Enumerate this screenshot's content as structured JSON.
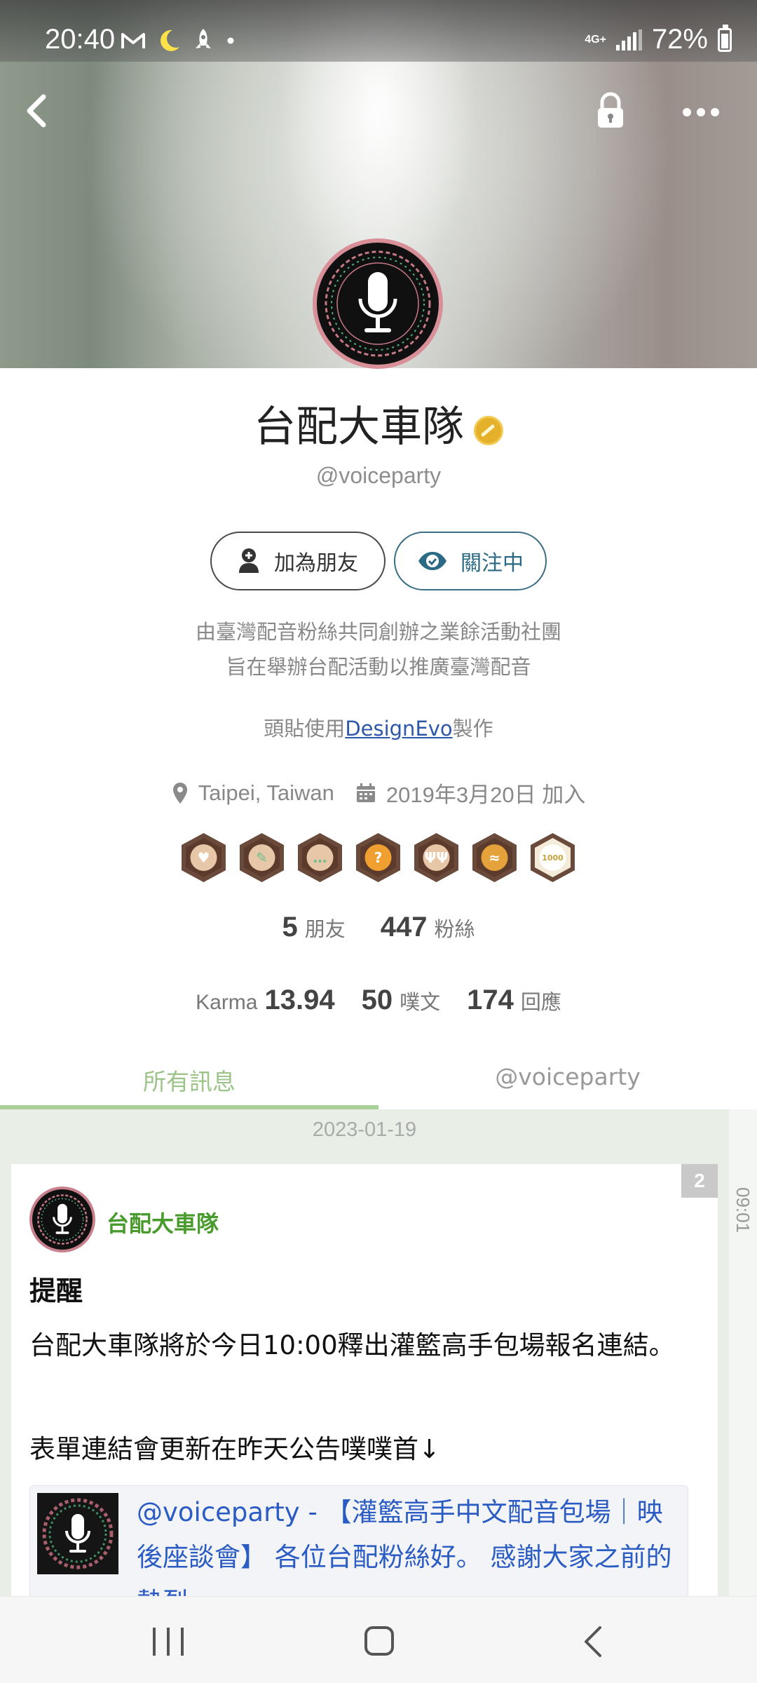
{
  "status_bar": {
    "time": "20:40",
    "network": "4G+",
    "battery": "72%",
    "battery_level": 0.72,
    "left_icons": [
      "gmail-icon",
      "moon-icon",
      "rocket-icon",
      "dot-icon"
    ]
  },
  "header": {
    "back_icon": "chevron-left-icon",
    "lock_icon": "lock-icon",
    "more_icon": "more-dots-icon"
  },
  "profile": {
    "name": "台配大車隊",
    "handle": "@voiceparty",
    "add_friend_label": "加為朋友",
    "following_label": "關注中",
    "bio_line1": "由臺灣配音粉絲共同創辦之業餘活動社團",
    "bio_line2": "旨在舉辦台配活動以推廣臺灣配音",
    "bio_credit_prefix": "頭貼使用",
    "bio_credit_link": "DesignEvo",
    "bio_credit_suffix": "製作",
    "location": "Taipei, Taiwan",
    "joined": "2019年3月20日 加入"
  },
  "badges": [
    {
      "name": "heart-badge-icon",
      "color": "#6a4a3a",
      "glyph": "♥"
    },
    {
      "name": "pencil-badge-icon",
      "color": "#6a4a3a",
      "glyph": "✎"
    },
    {
      "name": "chat-badge-icon",
      "color": "#6a4a3a",
      "glyph": "…"
    },
    {
      "name": "question-badge-icon",
      "color": "#6a4a3a",
      "glyph": "?"
    },
    {
      "name": "people-badge-icon",
      "color": "#6a4a3a",
      "glyph": "ΨΨ"
    },
    {
      "name": "bone-badge-icon",
      "color": "#6a4a3a",
      "glyph": "≈"
    },
    {
      "name": "1000-badge-icon",
      "color": "#6a4a3a",
      "glyph": "1000"
    }
  ],
  "stats": {
    "friends_num": "5",
    "friends_lbl": "朋友",
    "fans_num": "447",
    "fans_lbl": "粉絲",
    "karma_lbl": "Karma",
    "karma_num": "13.94",
    "plurks_num": "50",
    "plurks_lbl": "噗文",
    "responses_num": "174",
    "responses_lbl": "回應"
  },
  "tabs": [
    {
      "label": "所有訊息",
      "active": true
    },
    {
      "label": "@voiceparty",
      "active": false
    }
  ],
  "feed": {
    "date": "2023-01-19",
    "rail_time": "09:01",
    "post": {
      "count": "2",
      "author": "台配大車隊",
      "title": "提醒",
      "body_line1": "台配大車隊將於今日10:00釋出灌籃高手包場報名連結。",
      "body_line2": "表單連結會更新在昨天公告噗噗首↓",
      "link_text": "@voiceparty - 【灌籃高手中文配音包場｜映後座談會】 各位台配粉絲好。 感謝大家之前的熱烈"
    }
  },
  "navbar": {
    "recents_icon": "recents-icon",
    "home_icon": "home-icon",
    "back_icon": "back-icon"
  }
}
